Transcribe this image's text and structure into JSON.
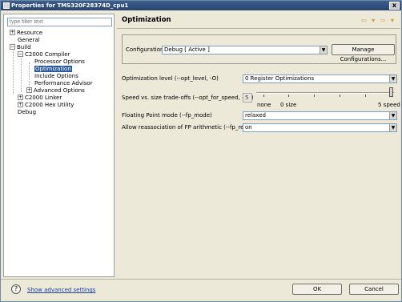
{
  "window": {
    "title": "Properties for TMS320F28374D_cpu1",
    "close_label": "x"
  },
  "sidebar": {
    "filter_placeholder": "type filter text",
    "items": [
      {
        "label": "Resource",
        "expander": "+"
      },
      {
        "label": "General",
        "expander": ""
      },
      {
        "label": "Build",
        "expander": "−"
      },
      {
        "label": "C2000 Compiler",
        "expander": "−"
      },
      {
        "label": "Processor Options",
        "expander": ""
      },
      {
        "label": "Optimization",
        "expander": ""
      },
      {
        "label": "Include Options",
        "expander": ""
      },
      {
        "label": "Performance Advisor",
        "expander": ""
      },
      {
        "label": "Advanced Options",
        "expander": "+"
      },
      {
        "label": "C2000 Linker",
        "expander": "+"
      },
      {
        "label": "C2000 Hex Utility",
        "expander": "+"
      },
      {
        "label": "Debug",
        "expander": ""
      }
    ],
    "selected_index": 5
  },
  "page": {
    "title": "Optimization",
    "nav_arrows": "⇦ ▾ ⇨ ▾",
    "configuration": {
      "label": "Configuration:",
      "value": "Debug  [ Active ]",
      "manage_button": "Manage Configurations..."
    },
    "fields": {
      "opt_level": {
        "label": "Optimization level (--opt_level, -O)",
        "value": "0 Register Optimizations"
      },
      "speed_size": {
        "label": "Speed vs. size trade-offs (--opt_for_speed, -mf)",
        "value": "5",
        "slider_level": 5,
        "slider_max": 5,
        "scale_labels": {
          "none": "none",
          "size": "0 size",
          "speed": "5 speed"
        }
      },
      "fp_mode": {
        "label": "Floating Point mode (--fp_mode)",
        "value": "relaxed"
      },
      "fp_reassoc": {
        "label": "Allow reassociation of FP arithmetic (--fp_reassoc)",
        "value": "on"
      }
    }
  },
  "footer": {
    "help_glyph": "?",
    "advanced_link": "Show advanced settings",
    "ok_label": "OK",
    "cancel_label": "Cancel"
  }
}
